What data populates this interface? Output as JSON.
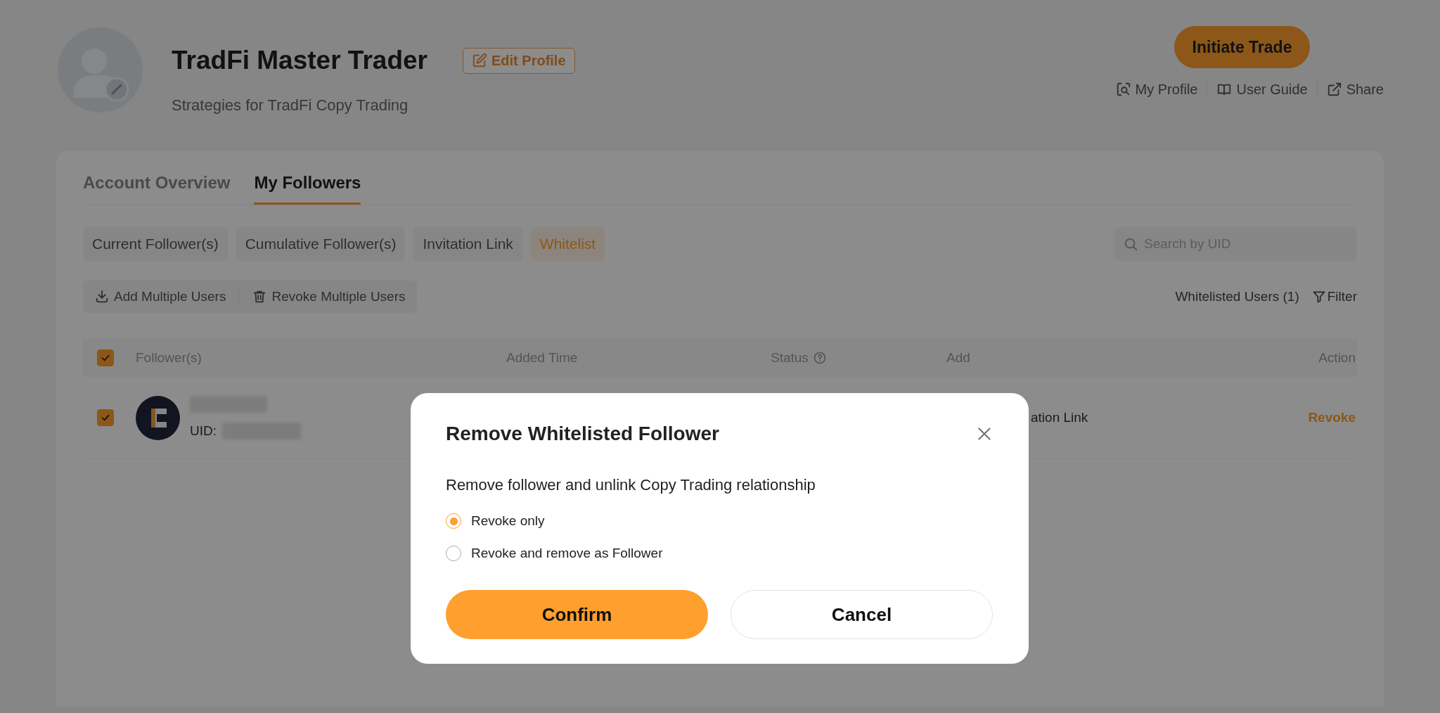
{
  "profile": {
    "name": "TradFi Master Trader",
    "edit_button": "Edit Profile",
    "subtitle": "Strategies for TradFi Copy Trading",
    "primary_action": "Initiate Trade",
    "links": [
      "My Profile",
      "User Guide",
      "Share"
    ]
  },
  "tabs": [
    {
      "label": "Account Overview",
      "selected": false
    },
    {
      "label": "My Followers",
      "selected": true
    }
  ],
  "sub_tabs": [
    {
      "label": "Current Follower(s)",
      "selected": false
    },
    {
      "label": "Cumulative Follower(s)",
      "selected": false
    },
    {
      "label": "Invitation Link",
      "selected": false
    },
    {
      "label": "Whitelist",
      "selected": true
    }
  ],
  "search": {
    "placeholder": "Search by UID"
  },
  "toolbar": {
    "actions": [
      "Add Multiple Users",
      "Revoke Multiple Users"
    ],
    "count": "Whitelisted Users (1)",
    "filter": "Filter"
  },
  "table": {
    "select_all_checked": true,
    "columns": [
      "Follower(s)",
      "Added Time",
      "Status",
      "Add",
      "Action"
    ],
    "rows": [
      {
        "checked": true,
        "uid_label": "UID:",
        "column_4": "ation Link",
        "action": "Revoke"
      }
    ]
  },
  "dialog": {
    "title": "Remove Whitelisted Follower",
    "description": "Remove follower and unlink Copy Trading relationship",
    "options": [
      {
        "label": "Revoke only",
        "selected": true
      },
      {
        "label": "Revoke and remove as Follower",
        "selected": false
      }
    ],
    "confirm": "Confirm",
    "cancel": "Cancel"
  }
}
